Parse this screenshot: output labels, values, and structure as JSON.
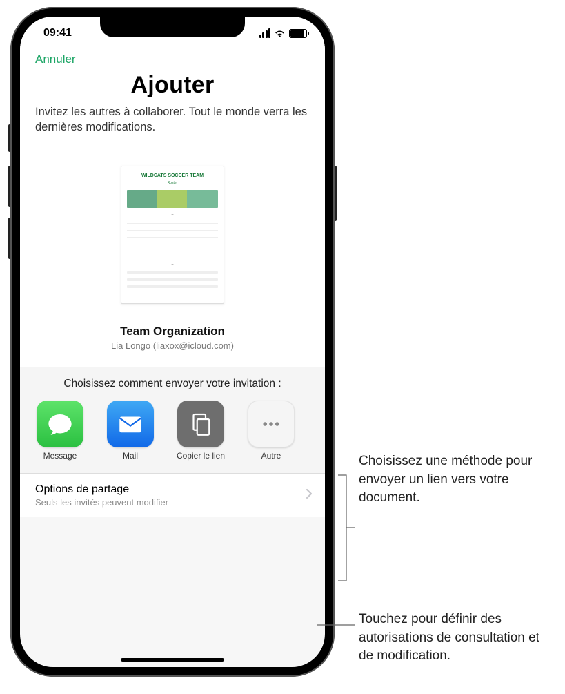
{
  "status": {
    "time": "09:41"
  },
  "nav": {
    "cancel": "Annuler"
  },
  "header": {
    "title": "Ajouter",
    "subtitle": "Invitez les autres à collaborer. Tout le monde verra les dernières modifications."
  },
  "document": {
    "thumb_title": "WILDCATS SOCCER TEAM",
    "thumb_sub": "Roster",
    "name": "Team Organization",
    "owner": "Lia Longo (liaxox@icloud.com)"
  },
  "invite": {
    "prompt": "Choisissez comment envoyer votre invitation :",
    "apps": [
      {
        "label": "Message",
        "icon": "message-icon"
      },
      {
        "label": "Mail",
        "icon": "mail-icon"
      },
      {
        "label": "Copier le lien",
        "icon": "copy-link-icon"
      },
      {
        "label": "Autre",
        "icon": "more-icon"
      }
    ]
  },
  "share_options": {
    "title": "Options de partage",
    "subtitle": "Seuls les invités peuvent modifier"
  },
  "callouts": {
    "method": "Choisissez une méthode pour envoyer un lien vers votre document.",
    "permissions": "Touchez pour définir des autorisations de consultation et de modification."
  }
}
